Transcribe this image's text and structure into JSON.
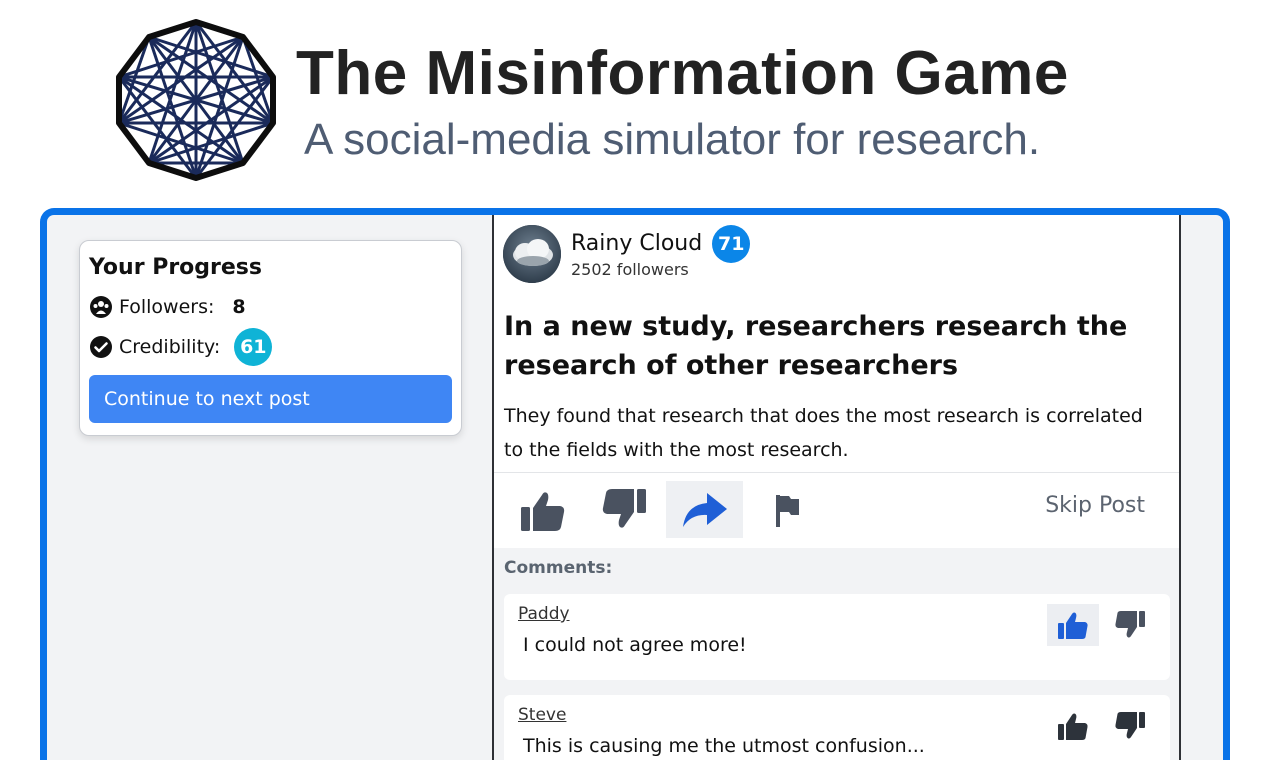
{
  "app": {
    "title": "The Misinformation Game",
    "subtitle": "A social-media simulator for research."
  },
  "progress": {
    "heading": "Your Progress",
    "followers_label": "Followers:",
    "followers_value": "8",
    "credibility_label": "Credibility:",
    "credibility_value": "61",
    "continue_label": "Continue to next post"
  },
  "post": {
    "author": "Rainy Cloud",
    "author_credibility": "71",
    "followers_text": "2502 followers",
    "headline": "In a new study, researchers research the research of other researchers",
    "body": "They found that research that does the most research is correlated to the fields with the most research.",
    "skip_label": "Skip Post",
    "selected_action": "share"
  },
  "comments": {
    "label": "Comments:",
    "items": [
      {
        "author": "Paddy",
        "text": "I could not agree more!",
        "liked": true
      },
      {
        "author": "Steve",
        "text": "This is causing me the utmost confusion...",
        "liked": false
      }
    ]
  },
  "colors": {
    "frame": "#0a73e8",
    "continue_button": "#3f86f4",
    "credibility_badge": "#0fb3d6",
    "author_badge": "#0b86e8",
    "share_active": "#1f5fd6",
    "icon_gray": "#4a5260"
  },
  "icons": [
    "network-logo-icon",
    "followers-icon",
    "credibility-check-icon",
    "like-icon",
    "dislike-icon",
    "share-icon",
    "flag-icon"
  ]
}
